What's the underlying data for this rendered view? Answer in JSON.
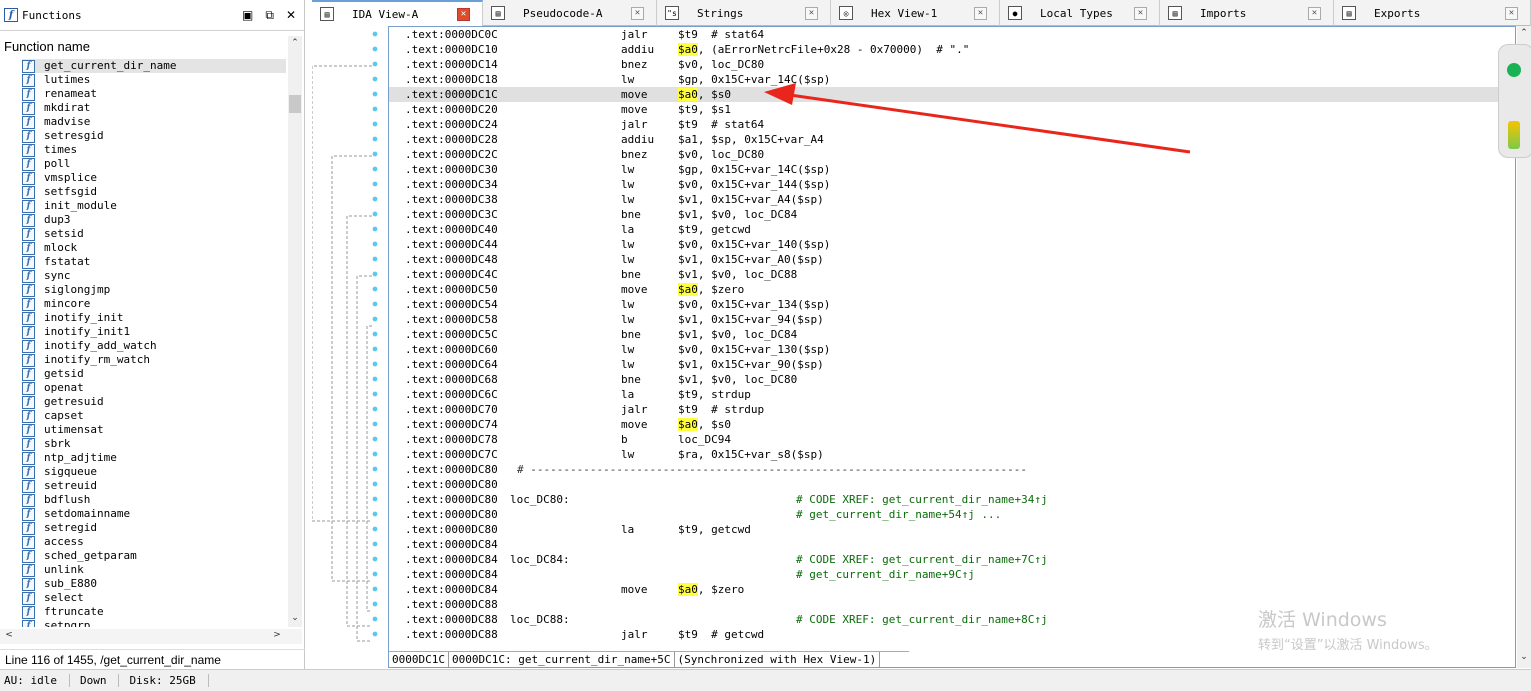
{
  "functions": {
    "title": "Functions",
    "column_header": "Function name",
    "selected_index": 0,
    "items": [
      "get_current_dir_name",
      "lutimes",
      "renameat",
      "mkdirat",
      "madvise",
      "setresgid",
      "times",
      "poll",
      "vmsplice",
      "setfsgid",
      "init_module",
      "dup3",
      "setsid",
      "mlock",
      "fstatat",
      "sync",
      "siglongjmp",
      "mincore",
      "inotify_init",
      "inotify_init1",
      "inotify_add_watch",
      "inotify_rm_watch",
      "getsid",
      "openat",
      "getresuid",
      "capset",
      "utimensat",
      "sbrk",
      "ntp_adjtime",
      "sigqueue",
      "setreuid",
      "bdflush",
      "setdomainname",
      "setregid",
      "access",
      "sched_getparam",
      "unlink",
      "sub_E880",
      "select",
      "ftruncate",
      "setpgrp"
    ],
    "status": "Line 116 of 1455, /get_current_dir_name"
  },
  "tabs": [
    {
      "label": "IDA View-A",
      "icon": "ida-view-icon",
      "active": true
    },
    {
      "label": "Pseudocode-A",
      "icon": "pseudocode-icon",
      "active": false
    },
    {
      "label": "Strings",
      "icon": "strings-icon",
      "active": false
    },
    {
      "label": "Hex View-1",
      "icon": "hex-view-icon",
      "active": false
    },
    {
      "label": "Local Types",
      "icon": "local-types-icon",
      "active": false
    },
    {
      "label": "Imports",
      "icon": "imports-icon",
      "active": false
    },
    {
      "label": "Exports",
      "icon": "exports-icon",
      "active": false
    }
  ],
  "disasm": {
    "current_line_index": 4,
    "lines": [
      {
        "addr": ".text:0000DC0C",
        "mn": "jalr",
        "op": [
          {
            "t": "$t9  # stat64"
          }
        ]
      },
      {
        "addr": ".text:0000DC10",
        "mn": "addiu",
        "op": [
          {
            "t": "$a0",
            "hl": true
          },
          {
            "t": ", (aErrorNetrcFile+0x28 - 0x70000)  # \".\""
          }
        ]
      },
      {
        "addr": ".text:0000DC14",
        "mn": "bnez",
        "op": [
          {
            "t": "$v0, loc_DC80"
          }
        ]
      },
      {
        "addr": ".text:0000DC18",
        "mn": "lw",
        "op": [
          {
            "t": "$gp, 0x15C+var_14C($sp)"
          }
        ]
      },
      {
        "addr": ".text:0000DC1C",
        "mn": "move",
        "op": [
          {
            "t": "$a0",
            "hl": true
          },
          {
            "t": ", $s0"
          }
        ]
      },
      {
        "addr": ".text:0000DC20",
        "mn": "move",
        "op": [
          {
            "t": "$t9, $s1"
          }
        ]
      },
      {
        "addr": ".text:0000DC24",
        "mn": "jalr",
        "op": [
          {
            "t": "$t9  # stat64"
          }
        ]
      },
      {
        "addr": ".text:0000DC28",
        "mn": "addiu",
        "op": [
          {
            "t": "$a1, $sp, 0x15C+var_A4"
          }
        ]
      },
      {
        "addr": ".text:0000DC2C",
        "mn": "bnez",
        "op": [
          {
            "t": "$v0, loc_DC80"
          }
        ]
      },
      {
        "addr": ".text:0000DC30",
        "mn": "lw",
        "op": [
          {
            "t": "$gp, 0x15C+var_14C($sp)"
          }
        ]
      },
      {
        "addr": ".text:0000DC34",
        "mn": "lw",
        "op": [
          {
            "t": "$v0, 0x15C+var_144($sp)"
          }
        ]
      },
      {
        "addr": ".text:0000DC38",
        "mn": "lw",
        "op": [
          {
            "t": "$v1, 0x15C+var_A4($sp)"
          }
        ]
      },
      {
        "addr": ".text:0000DC3C",
        "mn": "bne",
        "op": [
          {
            "t": "$v1, $v0, loc_DC84"
          }
        ]
      },
      {
        "addr": ".text:0000DC40",
        "mn": "la",
        "op": [
          {
            "t": "$t9, getcwd"
          }
        ]
      },
      {
        "addr": ".text:0000DC44",
        "mn": "lw",
        "op": [
          {
            "t": "$v0, 0x15C+var_140($sp)"
          }
        ]
      },
      {
        "addr": ".text:0000DC48",
        "mn": "lw",
        "op": [
          {
            "t": "$v1, 0x15C+var_A0($sp)"
          }
        ]
      },
      {
        "addr": ".text:0000DC4C",
        "mn": "bne",
        "op": [
          {
            "t": "$v1, $v0, loc_DC88"
          }
        ]
      },
      {
        "addr": ".text:0000DC50",
        "mn": "move",
        "op": [
          {
            "t": "$a0",
            "hl": true
          },
          {
            "t": ", $zero"
          }
        ]
      },
      {
        "addr": ".text:0000DC54",
        "mn": "lw",
        "op": [
          {
            "t": "$v0, 0x15C+var_134($sp)"
          }
        ]
      },
      {
        "addr": ".text:0000DC58",
        "mn": "lw",
        "op": [
          {
            "t": "$v1, 0x15C+var_94($sp)"
          }
        ]
      },
      {
        "addr": ".text:0000DC5C",
        "mn": "bne",
        "op": [
          {
            "t": "$v1, $v0, loc_DC84"
          }
        ]
      },
      {
        "addr": ".text:0000DC60",
        "mn": "lw",
        "op": [
          {
            "t": "$v0, 0x15C+var_130($sp)"
          }
        ]
      },
      {
        "addr": ".text:0000DC64",
        "mn": "lw",
        "op": [
          {
            "t": "$v1, 0x15C+var_90($sp)"
          }
        ]
      },
      {
        "addr": ".text:0000DC68",
        "mn": "bne",
        "op": [
          {
            "t": "$v1, $v0, loc_DC80"
          }
        ]
      },
      {
        "addr": ".text:0000DC6C",
        "mn": "la",
        "op": [
          {
            "t": "$t9, strdup"
          }
        ]
      },
      {
        "addr": ".text:0000DC70",
        "mn": "jalr",
        "op": [
          {
            "t": "$t9  # strdup"
          }
        ]
      },
      {
        "addr": ".text:0000DC74",
        "mn": "move",
        "op": [
          {
            "t": "$a0",
            "hl": true
          },
          {
            "t": ", $s0"
          }
        ]
      },
      {
        "addr": ".text:0000DC78",
        "mn": "b",
        "op": [
          {
            "t": "loc_DC94"
          }
        ]
      },
      {
        "addr": ".text:0000DC7C",
        "mn": "lw",
        "op": [
          {
            "t": "$ra, 0x15C+var_s8($sp)"
          }
        ]
      },
      {
        "addr": ".text:0000DC80",
        "sep": "# ---------------------------------------------------------------------------"
      },
      {
        "addr": ".text:0000DC80"
      },
      {
        "addr": ".text:0000DC80",
        "lbl": "loc_DC80:",
        "cm": "# CODE XREF: get_current_dir_name+34↑j"
      },
      {
        "addr": ".text:0000DC80",
        "cm": "# get_current_dir_name+54↑j ..."
      },
      {
        "addr": ".text:0000DC80",
        "mn": "la",
        "op": [
          {
            "t": "$t9, getcwd"
          }
        ]
      },
      {
        "addr": ".text:0000DC84"
      },
      {
        "addr": ".text:0000DC84",
        "lbl": "loc_DC84:",
        "cm": "# CODE XREF: get_current_dir_name+7C↑j"
      },
      {
        "addr": ".text:0000DC84",
        "cm": "# get_current_dir_name+9C↑j"
      },
      {
        "addr": ".text:0000DC84",
        "mn": "move",
        "op": [
          {
            "t": "$a0",
            "hl": true
          },
          {
            "t": ", $zero"
          }
        ]
      },
      {
        "addr": ".text:0000DC88"
      },
      {
        "addr": ".text:0000DC88",
        "lbl": "loc_DC88:",
        "cm": "# CODE XREF: get_current_dir_name+8C↑j"
      },
      {
        "addr": ".text:0000DC88",
        "mn": "jalr",
        "op": [
          {
            "t": "$t9  # getcwd"
          }
        ]
      }
    ],
    "status_cells": [
      "0000DC1C",
      "0000DC1C: get_current_dir_name+5C",
      "(Synchronized with Hex View-1)"
    ]
  },
  "watermark": {
    "line1": "激活 Windows",
    "line2": "转到“设置”以激活 Windows。"
  },
  "bottom_status": [
    "AU:  idle",
    "Down",
    "Disk: 25GB"
  ],
  "colors": {
    "highlight": "#ffff40",
    "arrow": "#e8261c",
    "comment": "#0a6b0a",
    "active_close": "#e04b2a"
  }
}
